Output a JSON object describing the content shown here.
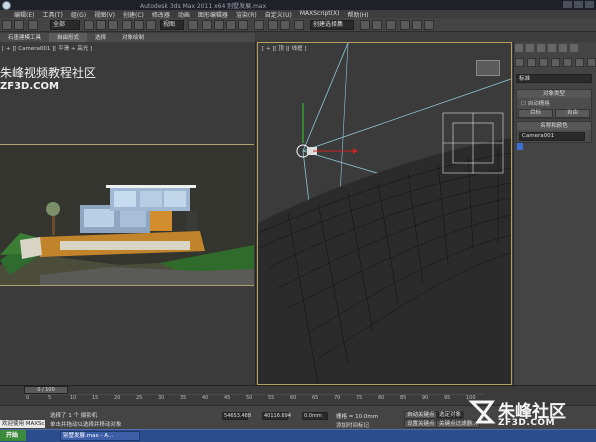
{
  "window": {
    "title": "Autodesk 3ds Max 2011 x64  别墅发展.max"
  },
  "menubar": {
    "items": [
      "编辑(E)",
      "工具(T)",
      "组(G)",
      "视图(V)",
      "创建(C)",
      "修改器",
      "动画",
      "图形编辑器",
      "渲染(R)",
      "自定义(U)",
      "MAXScript(X)",
      "帮助(H)"
    ]
  },
  "toolbar": {
    "filter_value": "全部",
    "view_value": "视图",
    "selection_set": "创建选择集"
  },
  "ribbon": {
    "tabs": [
      "石墨建模工具",
      "自由形式",
      "选择",
      "对象绘制"
    ]
  },
  "viewports": {
    "left_label": "[ + ][ Camera001 ][ 平滑 + 高光 ]",
    "right_label": "[ + ][ 顶 ][ 线框 ]"
  },
  "watermark": {
    "cn": "朱峰视频教程社区",
    "en": "ZF3D.COM"
  },
  "command_panel": {
    "dropdown_value": "标准",
    "object_type_title": "对象类型",
    "autogrid_label": "自动栅格",
    "btn_target": "目标",
    "btn_free": "自由",
    "name_color_title": "名称和颜色",
    "object_name": "Camera001",
    "swatch_color": "#3f6fd6"
  },
  "timeline": {
    "frame_display": "0 / 100",
    "ticks": [
      "0",
      "5",
      "10",
      "15",
      "20",
      "25",
      "30",
      "35",
      "40",
      "45",
      "50",
      "55",
      "60",
      "65",
      "70",
      "75",
      "80",
      "85",
      "90",
      "95",
      "100"
    ]
  },
  "status": {
    "welcome": "欢迎使用 MAXSc",
    "line1": "选择了 1 个 摄影机",
    "line2": "单击并拖动以选择并移动对象",
    "x": "54653.488",
    "y": "40116.694",
    "z": "0.0mm",
    "grid": "栅格 = 10.0mm",
    "auto_key": "自动关键点",
    "set_key": "设置关键点",
    "selected": "选定对象",
    "key_filter": "关键点过滤器...",
    "add_time_tag": "添加时间标记"
  },
  "taskbar": {
    "start": "开始",
    "items": [
      "别墅发展.max - A..."
    ]
  },
  "brand": {
    "cn": "朱峰社区",
    "en": "ZF3D.COM"
  }
}
